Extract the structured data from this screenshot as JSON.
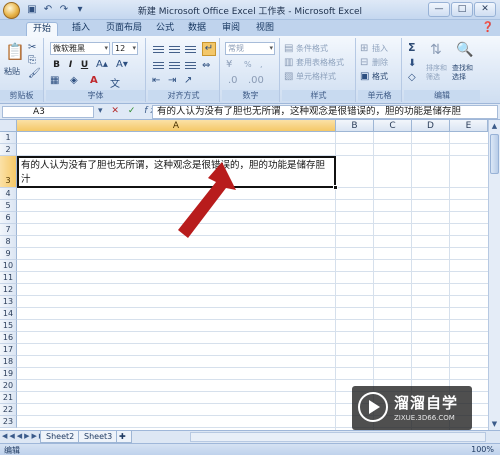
{
  "window": {
    "title": "新建 Microsoft Office Excel 工作表 - Microsoft Excel",
    "controls": [
      "—",
      "□",
      "✕"
    ]
  },
  "qat": {
    "icons": [
      "save-icon",
      "undo-icon",
      "redo-icon"
    ]
  },
  "ribbon": {
    "tabs": [
      "开始",
      "插入",
      "页面布局",
      "公式",
      "数据",
      "审阅",
      "视图"
    ],
    "groups": {
      "clipboard": {
        "label": "剪贴板",
        "paste": "粘贴"
      },
      "font": {
        "label": "字体",
        "name": "微软雅黑",
        "size": "12",
        "bold": "B",
        "italic": "I",
        "underline": "U"
      },
      "alignment": {
        "label": "对齐方式"
      },
      "number": {
        "label": "数字",
        "format": "常规",
        "percent": "%",
        "comma": ","
      },
      "styles": {
        "label": "样式",
        "conditional": "条件格式",
        "table": "套用表格格式",
        "cell": "单元格样式"
      },
      "cells": {
        "label": "单元格",
        "insert": "插入",
        "delete": "删除",
        "format": "格式"
      },
      "editing": {
        "label": "编辑",
        "sum": "Σ",
        "sort": "排序和筛选",
        "find": "查找和选择"
      }
    }
  },
  "formula_bar": {
    "name_box": "A3",
    "fx": "fx",
    "content": "有的人认为没有了胆也无所谓，这种观念是很错误的，胆的功能是储存胆"
  },
  "grid": {
    "columns": [
      "A",
      "B",
      "C",
      "D",
      "E"
    ],
    "selected_column": "A",
    "rows": [
      "1",
      "2",
      "3",
      "4",
      "5",
      "6",
      "7",
      "8",
      "9",
      "10",
      "11",
      "12",
      "13",
      "14",
      "15",
      "16",
      "17",
      "18",
      "19",
      "20",
      "21",
      "22",
      "23"
    ],
    "selected_row": "3",
    "cell_a3": "有的人认为没有了胆也无所谓，这种观念是很错误的，胆的功能是储存胆汁"
  },
  "sheets": [
    "Sheet2",
    "Sheet3"
  ],
  "status": {
    "mode": "编辑",
    "zoom": "100%"
  },
  "watermark": {
    "name": "溜溜自学",
    "url": "ZIXUE.3D66.COM"
  },
  "colors": {
    "annotation_arrow": "#b81c1c",
    "selection_header": "#f5c867",
    "ribbon": "#dde8f6"
  }
}
